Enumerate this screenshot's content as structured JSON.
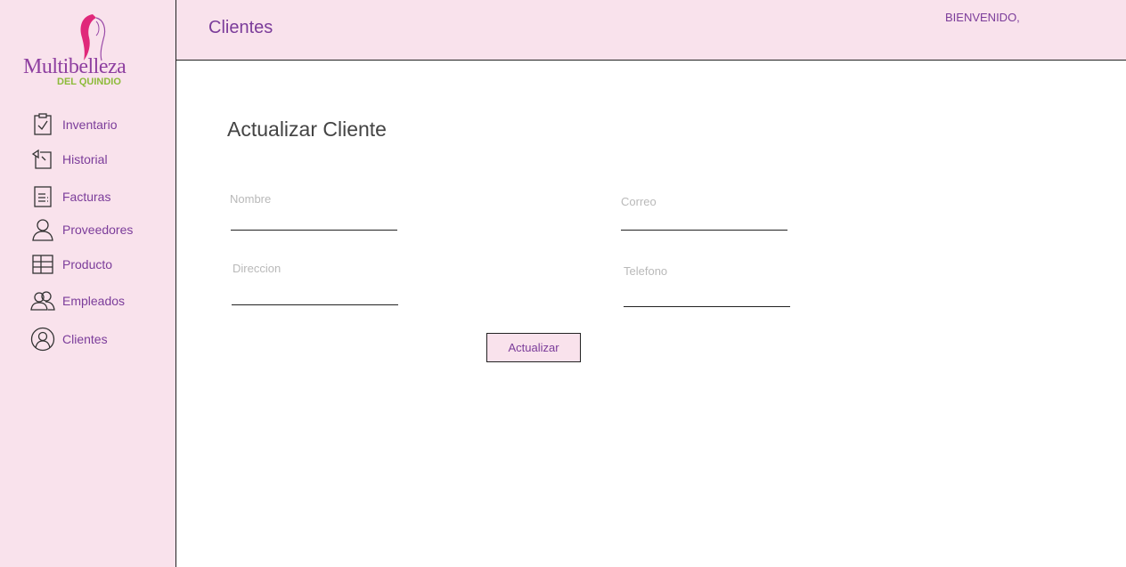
{
  "brand": {
    "name": "Multibelleza",
    "subtitle": "DEL QUINDIO"
  },
  "sidebar": {
    "items": [
      {
        "label": "Inventario",
        "icon": "clipboard-check-icon"
      },
      {
        "label": "Historial",
        "icon": "history-icon"
      },
      {
        "label": "Facturas",
        "icon": "invoice-icon"
      },
      {
        "label": "Proveedores",
        "icon": "user-icon"
      },
      {
        "label": "Producto",
        "icon": "grid-icon"
      },
      {
        "label": "Empleados",
        "icon": "users-icon"
      },
      {
        "label": "Clientes",
        "icon": "user-circle-icon"
      }
    ]
  },
  "header": {
    "title": "Clientes",
    "welcome": "BIENVENIDO,"
  },
  "form": {
    "title": "Actualizar Cliente",
    "fields": {
      "nombre": {
        "label": "Nombre",
        "value": ""
      },
      "correo": {
        "label": "Correo",
        "value": ""
      },
      "direccion": {
        "label": "Direccion",
        "value": ""
      },
      "telefono": {
        "label": "Telefono",
        "value": ""
      }
    },
    "submit_label": "Actualizar"
  },
  "colors": {
    "panel_bg": "#f9e2ec",
    "accent_text": "#7b3c9a",
    "logo_pink": "#e0287a",
    "logo_green": "#8dbb3a"
  }
}
